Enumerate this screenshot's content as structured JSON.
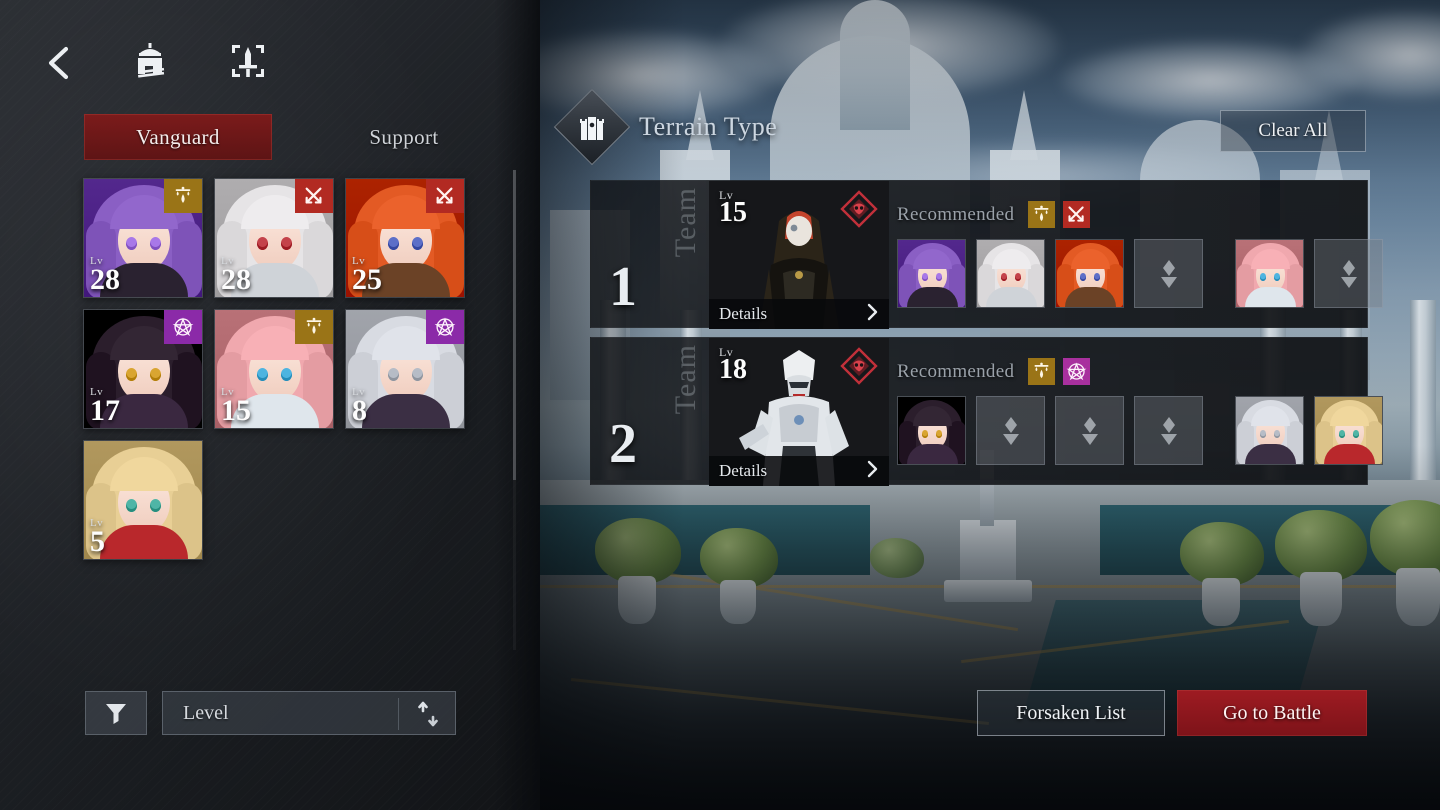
{
  "header": {
    "back_icon": "back-chevron-icon",
    "base_icon": "base-building-icon",
    "battle_icon": "battle-sword-icon"
  },
  "tabs": [
    {
      "label": "Vanguard",
      "active": true
    },
    {
      "label": "Support",
      "active": false
    }
  ],
  "characters": [
    {
      "level": "28",
      "lv_label": "Lv",
      "badge": "water-drop-scale-icon",
      "badge_color": "#9a7417",
      "hair": "#8a5fc4",
      "eye": "#a878e8",
      "body": "#2a2230"
    },
    {
      "level": "28",
      "lv_label": "Lv",
      "badge": "crossed-arrows-icon",
      "badge_color": "#b22a22",
      "hair": "#e6e4e6",
      "eye": "#c4424a",
      "body": "#cfd3d8"
    },
    {
      "level": "25",
      "lv_label": "Lv",
      "badge": "crossed-arrows-icon",
      "badge_color": "#b22a22",
      "hair": "#e35a24",
      "eye": "#5c6fc8",
      "body": "#6b4226"
    },
    {
      "level": "17",
      "lv_label": "Lv",
      "badge": "pentagram-icon",
      "badge_color": "#8b2aa8",
      "hair": "#2b1e2c",
      "eye": "#d9a531",
      "body": "#3a2840"
    },
    {
      "level": "15",
      "lv_label": "Lv",
      "badge": "water-drop-scale-icon",
      "badge_color": "#9a7417",
      "hair": "#f0a8ae",
      "eye": "#4db4e0",
      "body": "#dfe6ec"
    },
    {
      "level": "8",
      "lv_label": "Lv",
      "badge": "pentagram-icon",
      "badge_color": "#8b2aa8",
      "hair": "#d8dbe2",
      "eye": "#b6bcc6",
      "body": "#3b2f44"
    },
    {
      "level": "5",
      "lv_label": "Lv",
      "badge": "",
      "badge_color": "",
      "hair": "#e8cf95",
      "eye": "#4fb5a6",
      "body": "#b9282c"
    }
  ],
  "left_footer": {
    "filter_icon": "filter-funnel-icon",
    "sort_label": "Level",
    "sort_arrows_icon": "sort-up-down-icon"
  },
  "terrain": {
    "icon": "terrain-castle-icon",
    "title": "Terrain Type",
    "clear_all_label": "Clear All"
  },
  "teams": [
    {
      "number": "1",
      "word": "Team",
      "boss": {
        "lv_label": "Lv",
        "level": "15",
        "enemy_badge": "enemy-skull-diamond-icon",
        "details_label": "Details",
        "details_arrow": "chevron-right-icon",
        "art": "hooded-masked-assassin"
      },
      "recommended_label": "Recommended",
      "recommended_badges": [
        {
          "icon": "water-drop-scale-icon",
          "color": "#9a7417"
        },
        {
          "icon": "crossed-arrows-icon",
          "color": "#b22a22"
        }
      ],
      "slots": [
        {
          "state": "filled",
          "hair": "#8a5fc4",
          "eye": "#a878e8",
          "body": "#2a2230"
        },
        {
          "state": "filled",
          "hair": "#e6e4e6",
          "eye": "#c4424a",
          "body": "#cfd3d8"
        },
        {
          "state": "filled",
          "hair": "#e35a24",
          "eye": "#5c6fc8",
          "body": "#6b4226"
        },
        {
          "state": "empty",
          "placeholder_icon": "add-unit-diamond-icon"
        }
      ],
      "support_slots": [
        {
          "state": "filled",
          "hair": "#f0a8ae",
          "eye": "#4db4e0",
          "body": "#dfe6ec"
        },
        {
          "state": "empty",
          "placeholder_icon": "add-unit-diamond-icon"
        }
      ]
    },
    {
      "number": "2",
      "word": "Team",
      "boss": {
        "lv_label": "Lv",
        "level": "18",
        "enemy_badge": "enemy-skull-diamond-icon",
        "details_label": "Details",
        "details_arrow": "chevron-right-icon",
        "art": "white-armored-knight"
      },
      "recommended_label": "Recommended",
      "recommended_badges": [
        {
          "icon": "water-drop-scale-icon",
          "color": "#9a7417"
        },
        {
          "icon": "pentagram-icon",
          "color": "#a8309e"
        }
      ],
      "slots": [
        {
          "state": "filled",
          "hair": "#2b1e2c",
          "eye": "#d9a531",
          "body": "#3a2840"
        },
        {
          "state": "empty",
          "placeholder_icon": "add-unit-diamond-icon"
        },
        {
          "state": "empty",
          "placeholder_icon": "add-unit-diamond-icon"
        },
        {
          "state": "empty",
          "placeholder_icon": "add-unit-diamond-icon"
        }
      ],
      "support_slots": [
        {
          "state": "filled",
          "hair": "#d8dbe2",
          "eye": "#b6bcc6",
          "body": "#3b2f44"
        },
        {
          "state": "filled",
          "hair": "#e8cf95",
          "eye": "#4fb5a6",
          "body": "#b9282c"
        }
      ]
    }
  ],
  "footer": {
    "forsaken_label": "Forsaken List",
    "battle_label": "Go to Battle",
    "battle_color": "#8c171d"
  }
}
